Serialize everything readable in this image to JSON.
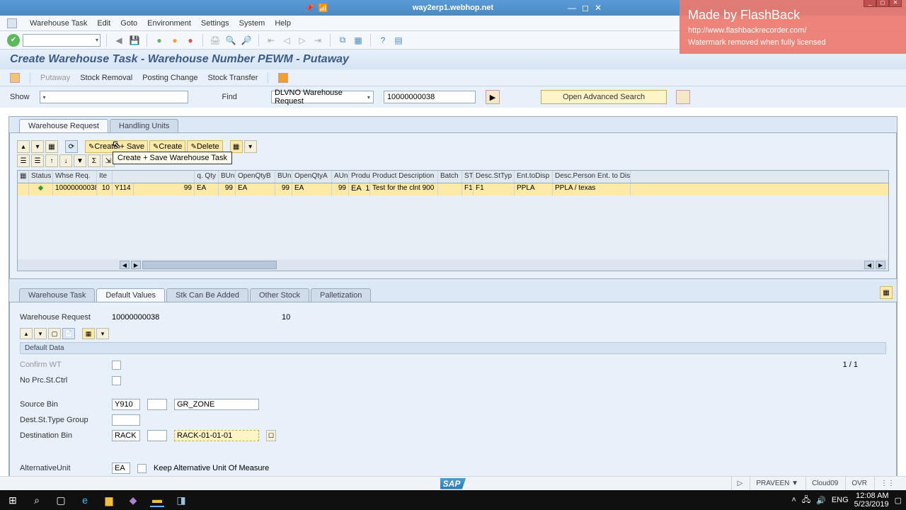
{
  "titlebar": {
    "url": "way2erp1.webhop.net"
  },
  "menu": {
    "items": [
      "Warehouse Task",
      "Edit",
      "Goto",
      "Environment",
      "Settings",
      "System",
      "Help"
    ]
  },
  "page": {
    "title": "Create Warehouse Task - Warehouse Number PEWM - Putaway"
  },
  "actions": {
    "putaway": "Putaway",
    "stock_removal": "Stock Removal",
    "posting_change": "Posting Change",
    "stock_transfer": "Stock Transfer"
  },
  "filter": {
    "show_label": "Show",
    "find_label": "Find",
    "find_type": "DLVNO Warehouse Request",
    "find_value": "10000000038",
    "adv_search": "Open Advanced Search"
  },
  "top_tabs": {
    "warehouse_request": "Warehouse Request",
    "handling_units": "Handling Units"
  },
  "alv_buttons": {
    "create_save": "Create + Save",
    "create": "Create",
    "delete": "Delete",
    "tooltip": "Create + Save Warehouse Task"
  },
  "table": {
    "headers": [
      "",
      "Status",
      "Whse Req.",
      "Ite",
      "",
      "q. Qty",
      "BUn",
      "OpenQtyB",
      "BUn",
      "OpenQtyA",
      "AUn",
      "Produ",
      "Product Description",
      "Batch",
      "ST",
      "Desc.StTyp",
      "Ent.toDisp",
      "Desc.Person Ent. to Disp"
    ],
    "row": {
      "status_icon": "◆",
      "whse_req": "10000000038",
      "item": "10",
      "prod_code": "Y114",
      "qty": "99",
      "bun": "EA",
      "open_qty_b": "99",
      "bun2": "EA",
      "open_qty_a": "99",
      "aun": "EA",
      "produ": "1",
      "prod_desc": "Test for the clnt 900",
      "batch": "",
      "st": "F1",
      "desc_sttyp": "F1",
      "ent_to_disp": "PPLA",
      "desc_person": "PPLA / texas",
      "extra_qty": "99",
      "extra_bun": "EA"
    }
  },
  "lower_tabs": {
    "warehouse_task": "Warehouse Task",
    "default_values": "Default Values",
    "stk_can_be_added": "Stk Can Be Added",
    "other_stock": "Other Stock",
    "palletization": "Palletization"
  },
  "form": {
    "wr_label": "Warehouse Request",
    "wr_value": "10000000038",
    "wr_item": "10",
    "section": "Default Data",
    "confirm_wt": "Confirm WT",
    "no_prc": "No Prc.St.Ctrl",
    "pager": "1   /   1",
    "source_bin": "Source Bin",
    "source_bin_v1": "Y910",
    "source_bin_v2": "GR_ZONE",
    "dest_group": "Dest.St.Type Group",
    "dest_bin": "Destination Bin",
    "dest_bin_v1": "RACK",
    "dest_bin_v2": "RACK-01-01-01",
    "alt_unit": "AlternativeUnit",
    "alt_unit_v": "EA",
    "keep_alt": "Keep Alternative Unit Of Measure"
  },
  "status": {
    "user": "PRAVEEN ▼",
    "client": "Cloud09",
    "ovr": "OVR"
  },
  "watermark": {
    "line1": "Made by FlashBack",
    "line2": "http://www.flashbackrecorder.com/",
    "line3": "Watermark removed when fully licensed"
  },
  "taskbar": {
    "time": "12:08 AM",
    "date": "5/23/2019",
    "lang": "ENG"
  }
}
